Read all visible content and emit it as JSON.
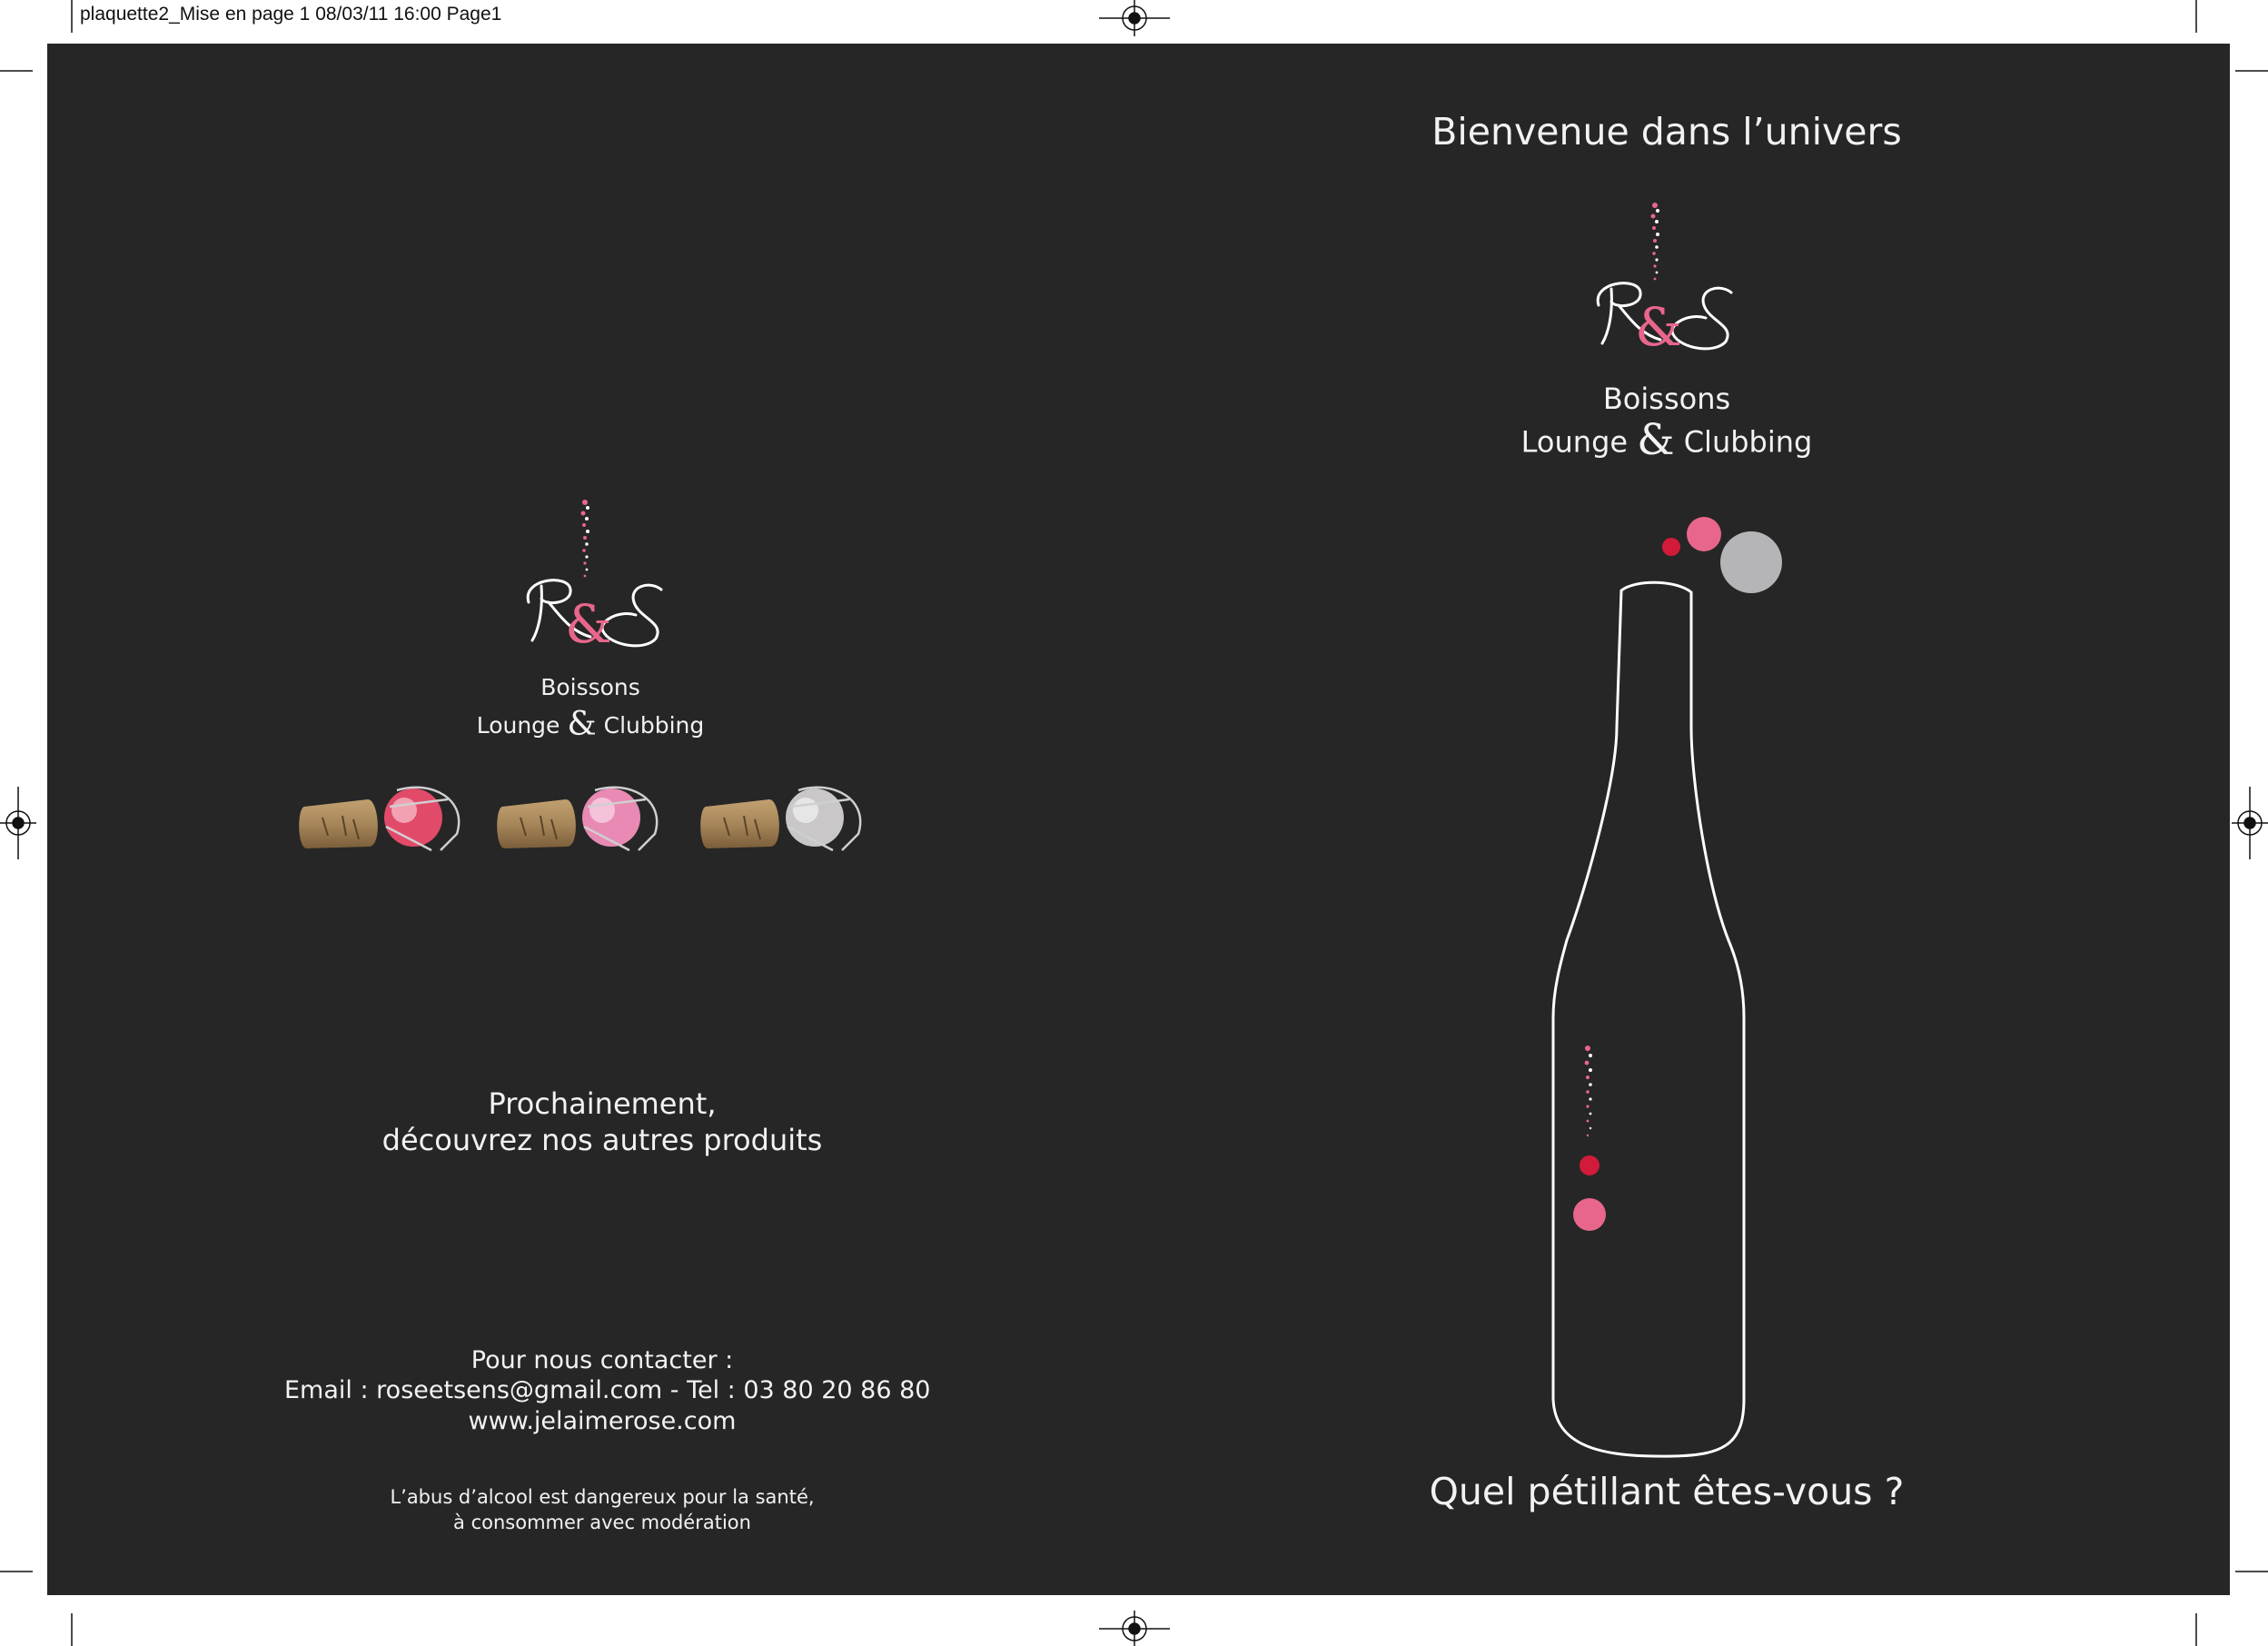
{
  "slug_line": "plaquette2_Mise en page 1  08/03/11  16:00  Page1",
  "colors": {
    "background": "#262626",
    "text": "#f2f2f2",
    "pink": "#e8668c",
    "red": "#d21a3a",
    "grey": "#b5b5b7",
    "cork": "#a7865a"
  },
  "back_cover": {
    "logo": {
      "letters_left": "R",
      "ampersand": "&",
      "letters_right": "S"
    },
    "brand_line1": "Boissons",
    "brand_line2_left": "Lounge",
    "brand_ampersand": "&",
    "brand_line2_right": "Clubbing",
    "products_line1": "Prochainement,",
    "products_line2": "découvrez nos autres produits",
    "contact_heading": "Pour nous contacter :",
    "contact_line": "Email : roseetsens@gmail.com - Tel : 03 80 20 86 80",
    "website": "www.jelaimerose.com",
    "disclaimer_line1": "L’abus d’alcool est dangereux pour la santé,",
    "disclaimer_line2": "à consommer avec modération"
  },
  "front_cover": {
    "welcome": "Bienvenue dans l’univers",
    "logo": {
      "letters_left": "R",
      "ampersand": "&",
      "letters_right": "S"
    },
    "brand_line1": "Boissons",
    "brand_line2_left": "Lounge",
    "brand_ampersand": "&",
    "brand_line2_right": "Clubbing",
    "tagline": "Quel pétillant êtes-vous ?"
  },
  "cork_products": [
    "cork-red-cap",
    "cork-pink-cap",
    "cork-silver-cap"
  ]
}
